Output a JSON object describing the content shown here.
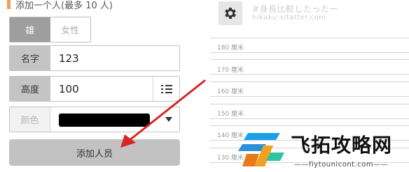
{
  "form": {
    "section_title": "添加一个人(最多 10 人)",
    "gender": {
      "male": "雄",
      "female": "女性",
      "selected": "雄"
    },
    "name": {
      "label": "名字",
      "value": "123"
    },
    "height": {
      "label": "高度",
      "value": "100"
    },
    "color": {
      "label": "颜色",
      "value": "#000000"
    },
    "add_button": "添加人员"
  },
  "chart": {
    "watermark_line1": "#身長比較したったー",
    "watermark_line2": "hikaku-sitatter.com",
    "ticks": [
      "180 厘米",
      "170 厘米",
      "160 厘米",
      "150 厘米",
      "140 厘米",
      "130 厘米"
    ]
  },
  "colors": {
    "accent": "#f29b5c",
    "arrow": "#d62626"
  },
  "icons": {
    "settings": "gear-icon",
    "list": "list-icon",
    "dropdown": "caret-down-icon"
  },
  "watermark": {
    "brand": "飞拓攻略网",
    "url": "——fiytounicont.com——"
  }
}
